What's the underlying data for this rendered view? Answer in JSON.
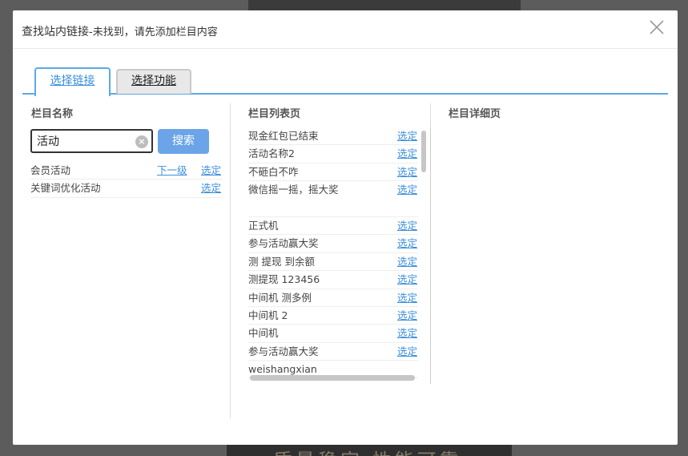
{
  "background": {
    "bottom_text": "质量稳定  性能可靠"
  },
  "dialog": {
    "title": "查找站内链接",
    "subtitle": "-未找到，请先添加栏目内容",
    "close_icon": "close-icon"
  },
  "tabs": [
    {
      "label": "选择链接",
      "active": true
    },
    {
      "label": "选择功能",
      "active": false
    }
  ],
  "columns": {
    "category_name": "栏目名称",
    "list_page": "栏目列表页",
    "detail_page": "栏目详细页"
  },
  "search": {
    "value": "活动",
    "clear_icon": "clear-icon",
    "button_label": "搜索"
  },
  "category_rows": [
    {
      "name": "会员活动",
      "next_label": "下一级",
      "select_label": "选定"
    },
    {
      "name": "关键词优化活动",
      "next_label": "",
      "select_label": "选定"
    }
  ],
  "list_rows": [
    {
      "name": "现金红包已结束",
      "select_label": "选定"
    },
    {
      "name": "活动名称2",
      "select_label": "选定"
    },
    {
      "name": "不砸白不咋",
      "select_label": "选定"
    },
    {
      "name": "微信摇一摇，摇大奖",
      "select_label": "选定"
    },
    {
      "name": "正式机",
      "select_label": "选定"
    },
    {
      "name": "参与活动赢大奖",
      "select_label": "选定"
    },
    {
      "name": "测 提现 到余额",
      "select_label": "选定"
    },
    {
      "name": "测提现 123456",
      "select_label": "选定"
    },
    {
      "name": "中间机 测多例",
      "select_label": "选定"
    },
    {
      "name": "中间机 2",
      "select_label": "选定"
    },
    {
      "name": "中间机",
      "select_label": "选定"
    },
    {
      "name": "参与活动赢大奖",
      "select_label": "选定"
    },
    {
      "name": "weishangxian",
      "select_label": ""
    }
  ],
  "colors": {
    "accent": "#5ea9e5",
    "link": "#3c8fdc",
    "button": "#6ba4e8"
  }
}
